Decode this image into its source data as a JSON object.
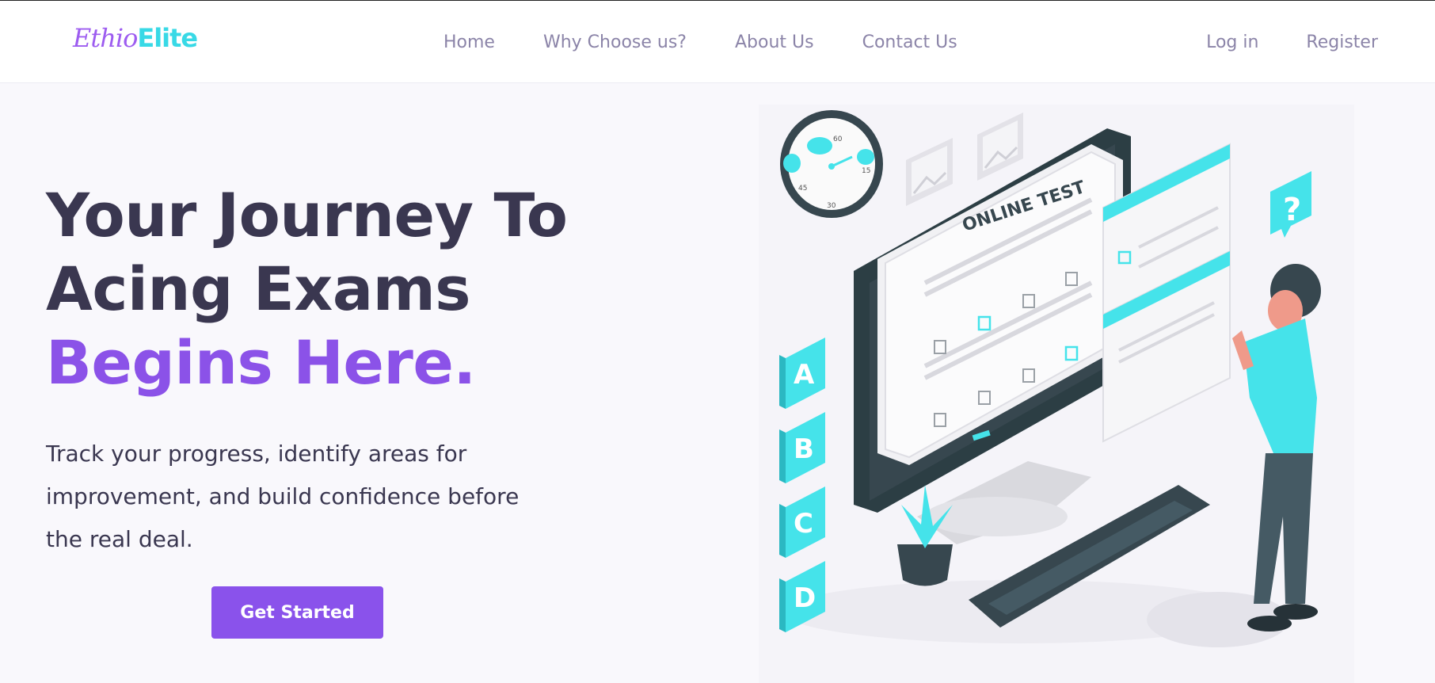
{
  "brand": {
    "part1": "Ethio",
    "part2": "Elite"
  },
  "nav": {
    "home": "Home",
    "why": "Why Choose us?",
    "about": "About Us",
    "contact": "Contact Us",
    "login": "Log in",
    "register": "Register"
  },
  "hero": {
    "line1": "Your Journey To",
    "line2": "Acing Exams",
    "line3": "Begins Here.",
    "description": "Track your progress, identify areas for improvement, and build confidence before the real deal.",
    "cta": "Get Started"
  },
  "illustration": {
    "screen_title": "ONLINE TEST",
    "options": [
      "A",
      "B",
      "C",
      "D"
    ],
    "stopwatch_ticks": [
      "60",
      "15",
      "30",
      "45"
    ],
    "question_mark": "?"
  },
  "colors": {
    "accent_purple": "#8a52eb",
    "accent_cyan": "#45e3ea",
    "text_dark": "#3a3750",
    "nav_text": "#8b84a8"
  }
}
